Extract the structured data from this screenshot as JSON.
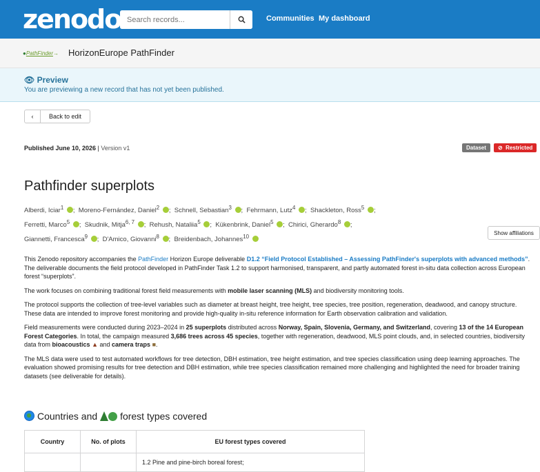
{
  "header": {
    "logo": "zenodo",
    "search_placeholder": "Search records...",
    "nav": [
      "Communities",
      "My dashboard"
    ]
  },
  "community": {
    "logo_text": "PathFinder",
    "title": "HorizonEurope PathFinder"
  },
  "preview": {
    "title": "Preview",
    "message": "You are previewing a new record that has not yet been published."
  },
  "back_button": "Back to edit",
  "published": {
    "date": "Published June 10, 2026",
    "version": "Version v1"
  },
  "badges": {
    "type": "Dataset",
    "access": "Restricted"
  },
  "record": {
    "title": "Pathfinder superplots",
    "authors": [
      {
        "name": "Alberdi, Iciar",
        "aff": "1"
      },
      {
        "name": "Moreno-Fernández, Daniel",
        "aff": "2"
      },
      {
        "name": "Schnell, Sebastian",
        "aff": "3"
      },
      {
        "name": "Fehrmann, Lutz",
        "aff": "4"
      },
      {
        "name": "Shackleton, Ross",
        "aff": "5"
      },
      {
        "name": "Ferretti, Marco",
        "aff": "5"
      },
      {
        "name": "Skudnik, Mitja",
        "aff": "6, 7"
      },
      {
        "name": "Rehush, Nataliia",
        "aff": "5"
      },
      {
        "name": "Kükenbrink, Daniel",
        "aff": "5"
      },
      {
        "name": "Chirici, Gherardo",
        "aff": "8"
      },
      {
        "name": "Giannetti, Francesca",
        "aff": "9"
      },
      {
        "name": "D'Amico, Giovanni",
        "aff": "8"
      },
      {
        "name": "Breidenbach, Johannes",
        "aff": "10"
      }
    ],
    "show_affiliations": "Show affiliations"
  },
  "description": {
    "p1_a": "This Zenodo repository accompanies the ",
    "p1_link1": "PathFinder",
    "p1_b": " Horizon Europe deliverable ",
    "p1_link2": "D1.2 “Field Protocol Established – Assessing PathFinder's superplots with advanced methods”",
    "p1_c": ". The deliverable documents the field protocol developed in PathFinder Task 1.2 to support harmonised, transparent, and partly automated forest in-situ data collection across European forest “superplots”.",
    "p2_a": "The work focuses on combining traditional forest field measurements with ",
    "p2_b": "mobile laser scanning (MLS)",
    "p2_c": " and biodiversity monitoring tools.",
    "p3": "The protocol supports the collection of tree-level variables such as diameter at breast height, tree height, tree species, tree position, regeneration, deadwood, and canopy structure. These data are intended to improve forest monitoring and provide high-quality in-situ reference information for Earth observation calibration and validation.",
    "p4_a": "Field measurements were conducted during 2023–2024 in ",
    "p4_b": "25 superplots",
    "p4_c": " distributed across ",
    "p4_d": "Norway, Spain, Slovenia, Germany, and Switzerland",
    "p4_e": ", covering ",
    "p4_f": "13 of the 14 European Forest Categories",
    "p4_g": ". In total, the campaign measured ",
    "p4_h": "3,686 trees across 45 species",
    "p4_i": ", together with regeneration, deadwood, MLS point clouds, and, in selected countries, biodiversity data from ",
    "p4_j": "bioacoustics",
    "p4_k": " and ",
    "p4_l": "camera traps",
    "p4_m": ".",
    "p5": "The MLS data were used to test automated workflows for tree detection, DBH estimation, tree height estimation, and tree species classification using deep learning approaches. The evaluation showed promising results for tree detection and DBH estimation, while tree species classification remained more challenging and highlighted the need for broader training datasets (see deliverable for details)."
  },
  "section": {
    "heading_a": "Countries and",
    "heading_b": "forest types covered"
  },
  "table": {
    "headers": [
      "Country",
      "No. of plots",
      "EU forest types covered"
    ],
    "rows": [
      [
        "",
        "",
        "1.2 Pine and pine-birch boreal forest;"
      ]
    ]
  }
}
